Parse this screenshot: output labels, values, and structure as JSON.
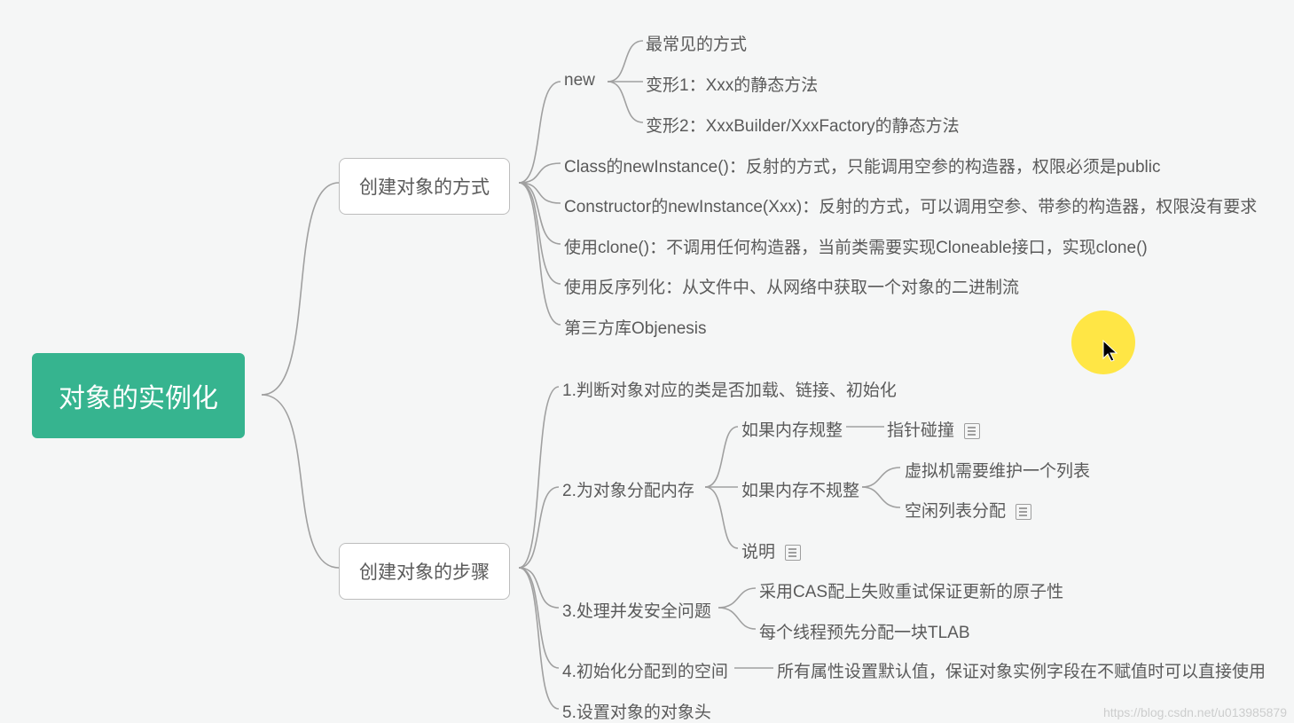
{
  "root": {
    "title": "对象的实例化"
  },
  "branch1": {
    "title": "创建对象的方式",
    "new_label": "new",
    "new_children": {
      "c1": "最常见的方式",
      "c2": "变形1：Xxx的静态方法",
      "c3": "变形2：XxxBuilder/XxxFactory的静态方法"
    },
    "items": {
      "i2": "Class的newInstance()：反射的方式，只能调用空参的构造器，权限必须是public",
      "i3": "Constructor的newInstance(Xxx)：反射的方式，可以调用空参、带参的构造器，权限没有要求",
      "i4": "使用clone()：不调用任何构造器，当前类需要实现Cloneable接口，实现clone()",
      "i5": "使用反序列化：从文件中、从网络中获取一个对象的二进制流",
      "i6": "第三方库Objenesis"
    }
  },
  "branch2": {
    "title": "创建对象的步骤",
    "s1": "1.判断对象对应的类是否加载、链接、初始化",
    "s2": {
      "label": "2.为对象分配内存",
      "a1": {
        "label": "如果内存规整",
        "child": "指针碰撞"
      },
      "a2": {
        "label": "如果内存不规整",
        "c1": "虚拟机需要维护一个列表",
        "c2": "空闲列表分配"
      },
      "a3": "说明"
    },
    "s3": {
      "label": "3.处理并发安全问题",
      "c1": "采用CAS配上失败重试保证更新的原子性",
      "c2": "每个线程预先分配一块TLAB"
    },
    "s4": {
      "label": "4.初始化分配到的空间",
      "child": "所有属性设置默认值，保证对象实例字段在不赋值时可以直接使用"
    },
    "s5": "5.设置对象的对象头"
  },
  "watermark": "https://blog.csdn.net/u013985879"
}
